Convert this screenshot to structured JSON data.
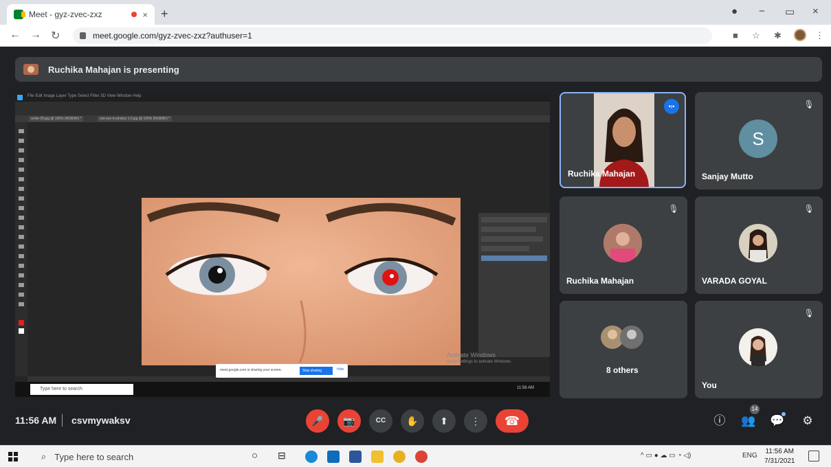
{
  "browser": {
    "tab_title": "Meet - gyz-zvec-zxz",
    "tab_close": "×",
    "new_tab": "+",
    "url": "meet.google.com/gyz-zvec-zxz?authuser=1",
    "window_controls": [
      "−",
      "▭",
      "×"
    ]
  },
  "banner": {
    "text": "Ruchika Mahajan is presenting"
  },
  "shared_screen": {
    "ps_menu": "File  Edit  Image  Layer  Type  Select  Filter  3D  View  Window  Help",
    "ps_doc_tabs": [
      "smile-25.jpg @ 100% (RGB/8#) *",
      "red-eye-in-photos 1.0.jpg @ 100% (RGB/8#) *"
    ],
    "share_notice": "meet.google.com is sharing your screen.",
    "stop_sharing": "Stop sharing",
    "hide": "Hide",
    "activate_line1": "Activate Windows",
    "activate_line2": "Go to Settings to activate Windows.",
    "taskbar_search": "Type here to search",
    "taskbar_time": "11:56 AM"
  },
  "participants": [
    {
      "name": "Ruchika Mahajan",
      "speaking": true
    },
    {
      "name": "Sanjay Mutto",
      "initial": "S"
    },
    {
      "name": "Ruchika Mahajan"
    },
    {
      "name": "VARADA GOYAL"
    },
    {
      "name": "8 others"
    },
    {
      "name": "You"
    }
  ],
  "meeting": {
    "time": "11:56 AM",
    "code": "csvmywaksv",
    "people_count": "14"
  },
  "controls": {
    "mic": "🎤",
    "camera": "📷",
    "captions": "CC",
    "raise_hand": "✋",
    "present": "⬆",
    "more": "⋮",
    "hangup": "☎",
    "info": "ⓘ",
    "people": "👥",
    "chat": "💬",
    "activities": "⚙"
  },
  "taskbar": {
    "search_placeholder": "Type here to search",
    "language": "ENG",
    "clock_time": "11:56 AM",
    "clock_date": "7/31/2021"
  },
  "colors": {
    "meet_bg": "#202124",
    "tile_bg": "#3c4043",
    "red": "#ea4335",
    "blue": "#1a73e8",
    "active_border": "#8ab4f8"
  }
}
